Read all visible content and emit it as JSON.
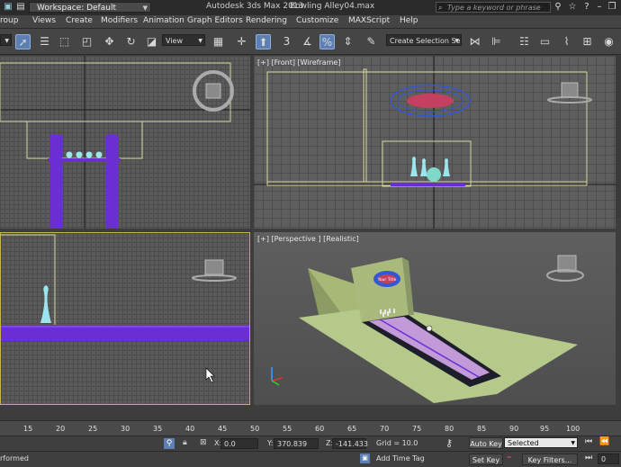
{
  "titlebar": {
    "menu_fragment": "",
    "workspace": "Workspace: Default",
    "app_title": "Autodesk 3ds Max  2013",
    "file_name": "Bowling Alley04.max",
    "search_placeholder": "Type a keyword or phrase"
  },
  "menu": {
    "items": [
      "roup",
      "Views",
      "Create",
      "Modifiers",
      "Animation",
      "Graph Editors",
      "Rendering",
      "Customize",
      "MAXScript",
      "Help"
    ]
  },
  "toolbar": {
    "ref_coord": "View",
    "selection_set": "Create Selection Se",
    "snap_number": "3"
  },
  "viewports": {
    "front_label": "[+] [Front] [Wireframe]",
    "persp_label": "[+] [Perspective ] [Realistic]",
    "sign_text": "Your Title"
  },
  "timeline": {
    "ticks": [
      "15",
      "20",
      "25",
      "30",
      "35",
      "40",
      "45",
      "50",
      "55",
      "60",
      "65",
      "70",
      "75",
      "80",
      "85",
      "90",
      "95",
      "100"
    ]
  },
  "status": {
    "x_label": "X:",
    "x_value": "0.0",
    "y_label": "Y:",
    "y_value": "370.839",
    "z_label": "Z:",
    "z_value": "-141.433",
    "grid": "Grid = 10.0",
    "auto_key": "Auto Key",
    "set_key": "Set Key",
    "key_filter_value": "Selected",
    "key_filters": "Key Filters...",
    "add_time_tag": "Add Time Tag",
    "prompt": "rformed",
    "frame": "0"
  },
  "colors": {
    "selection_blue": "#5d7fb2",
    "lane_purple": "#6a2fd2",
    "floor_green": "#b5c98b",
    "sign_blue": "#3457d2",
    "pin_cyan": "#9be6ee"
  }
}
